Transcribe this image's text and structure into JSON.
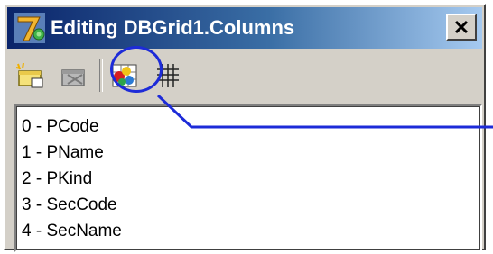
{
  "window": {
    "title": "Editing DBGrid1.Columns",
    "close_label": "X"
  },
  "toolbar": {
    "buttons": [
      {
        "name": "add-new-icon"
      },
      {
        "name": "delete-icon"
      },
      {
        "name": "add-all-fields-icon"
      },
      {
        "name": "restore-defaults-icon"
      }
    ]
  },
  "columns_list": {
    "items": [
      {
        "label": "0 - PCode"
      },
      {
        "label": "1 - PName"
      },
      {
        "label": "2 - PKind"
      },
      {
        "label": "3 - SecCode"
      },
      {
        "label": "4 - SecName"
      }
    ]
  },
  "colors": {
    "title_gradient_start": "#0a246a",
    "title_gradient_end": "#a6caf0",
    "window_face": "#d4d0c8",
    "annotation_blue": "#1d2bd8"
  }
}
